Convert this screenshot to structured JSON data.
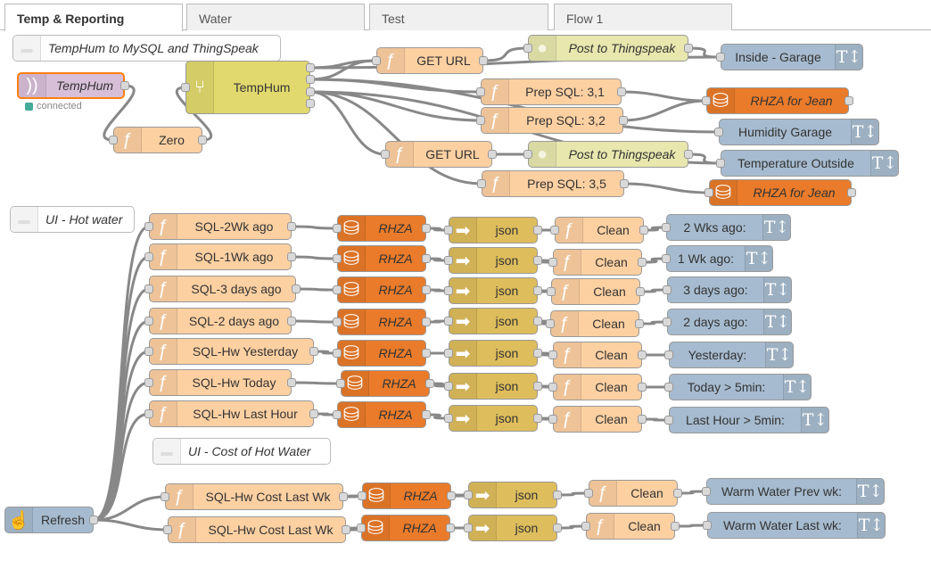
{
  "tabs": [
    {
      "label": "Temp & Reporting",
      "active": true
    },
    {
      "label": "Water"
    },
    {
      "label": "Test"
    },
    {
      "label": "Flow 1"
    }
  ],
  "colors": {
    "function": "#fdd0a2",
    "mysql": "#e97b2a",
    "json": "#debd5c",
    "ui": "#a6bbcf",
    "http": "#e7e7ae",
    "switch": "#e2d96e",
    "mqtt": "#d8bfd8",
    "inject": "#a6bbcf",
    "comment": "#ffffff",
    "wire": "#888888",
    "selected": "#ff7f0e"
  },
  "icons": {
    "function": "function-icon",
    "mysql": "database-icon",
    "json": "json-arrow-icon",
    "ui": "text-icon",
    "http": "globe-icon",
    "switch": "switch-icon",
    "mqtt": "mqtt-icon",
    "inject": "hand-pointer-icon",
    "comment": "comment-icon"
  },
  "nodes": [
    {
      "id": "c1",
      "type": "comment",
      "label": "TempHum to MySQL and ThingSpeak"
    },
    {
      "id": "mq",
      "type": "mqtt",
      "label": "TempHum",
      "italic": true,
      "selected": true,
      "status": "connected"
    },
    {
      "id": "zero",
      "type": "function",
      "label": "Zero"
    },
    {
      "id": "sw",
      "type": "switch",
      "label": "TempHum"
    },
    {
      "id": "get1",
      "type": "function",
      "label": "GET URL"
    },
    {
      "id": "post1",
      "type": "http",
      "label": "Post to Thingspeak",
      "italic": true
    },
    {
      "id": "ig",
      "type": "ui",
      "label": "Inside - Garage"
    },
    {
      "id": "ps31",
      "type": "function",
      "label": "Prep SQL: 3,1"
    },
    {
      "id": "rh1",
      "type": "mysql",
      "label": "RHZA for Jean",
      "italic": true
    },
    {
      "id": "ps32",
      "type": "function",
      "label": "Prep SQL: 3,2"
    },
    {
      "id": "hg",
      "type": "ui",
      "label": "Humidity Garage"
    },
    {
      "id": "get2",
      "type": "function",
      "label": "GET URL"
    },
    {
      "id": "post2",
      "type": "http",
      "label": "Post to Thingspeak",
      "italic": true
    },
    {
      "id": "to",
      "type": "ui",
      "label": "Temperature Outside"
    },
    {
      "id": "ps35",
      "type": "function",
      "label": "Prep SQL: 3,5"
    },
    {
      "id": "rh2",
      "type": "mysql",
      "label": "RHZA for Jean",
      "italic": true
    },
    {
      "id": "c2",
      "type": "comment",
      "label": "UI - Hot water"
    },
    {
      "id": "f1",
      "type": "function",
      "label": "SQL-2Wk ago"
    },
    {
      "id": "d1",
      "type": "mysql",
      "label": "RHZA",
      "italic": true
    },
    {
      "id": "j1",
      "type": "json",
      "label": "json"
    },
    {
      "id": "k1",
      "type": "function",
      "label": "Clean"
    },
    {
      "id": "u1",
      "type": "ui",
      "label": "2 Wks ago:"
    },
    {
      "id": "f2",
      "type": "function",
      "label": "SQL-1Wk ago"
    },
    {
      "id": "d2",
      "type": "mysql",
      "label": "RHZA",
      "italic": true
    },
    {
      "id": "j2",
      "type": "json",
      "label": "json"
    },
    {
      "id": "k2",
      "type": "function",
      "label": "Clean"
    },
    {
      "id": "u2",
      "type": "ui",
      "label": "1 Wk ago:"
    },
    {
      "id": "f3",
      "type": "function",
      "label": "SQL-3 days ago"
    },
    {
      "id": "d3",
      "type": "mysql",
      "label": "RHZA",
      "italic": true
    },
    {
      "id": "j3",
      "type": "json",
      "label": "json"
    },
    {
      "id": "k3",
      "type": "function",
      "label": "Clean"
    },
    {
      "id": "u3",
      "type": "ui",
      "label": "3 days ago:"
    },
    {
      "id": "f4",
      "type": "function",
      "label": "SQL-2 days ago"
    },
    {
      "id": "d4",
      "type": "mysql",
      "label": "RHZA",
      "italic": true
    },
    {
      "id": "j4",
      "type": "json",
      "label": "json"
    },
    {
      "id": "k4",
      "type": "function",
      "label": "Clean"
    },
    {
      "id": "u4",
      "type": "ui",
      "label": "2 days ago:"
    },
    {
      "id": "f5",
      "type": "function",
      "label": "SQL-Hw Yesterday"
    },
    {
      "id": "d5",
      "type": "mysql",
      "label": "RHZA",
      "italic": true
    },
    {
      "id": "j5",
      "type": "json",
      "label": "json"
    },
    {
      "id": "k5",
      "type": "function",
      "label": "Clean"
    },
    {
      "id": "u5",
      "type": "ui",
      "label": "Yesterday:"
    },
    {
      "id": "f6",
      "type": "function",
      "label": "SQL-Hw Today"
    },
    {
      "id": "d6",
      "type": "mysql",
      "label": "RHZA",
      "italic": true
    },
    {
      "id": "j6",
      "type": "json",
      "label": "json"
    },
    {
      "id": "k6",
      "type": "function",
      "label": "Clean"
    },
    {
      "id": "u6",
      "type": "ui",
      "label": "Today > 5min:"
    },
    {
      "id": "f7",
      "type": "function",
      "label": "SQL-Hw Last Hour"
    },
    {
      "id": "d7",
      "type": "mysql",
      "label": "RHZA",
      "italic": true
    },
    {
      "id": "j7",
      "type": "json",
      "label": "json"
    },
    {
      "id": "k7",
      "type": "function",
      "label": "Clean"
    },
    {
      "id": "u7",
      "type": "ui",
      "label": "Last Hour > 5min:"
    },
    {
      "id": "c3",
      "type": "comment",
      "label": "UI - Cost of Hot Water"
    },
    {
      "id": "ref",
      "type": "inject",
      "label": "Refresh"
    },
    {
      "id": "f8",
      "type": "function",
      "label": "SQL-Hw Cost Last Wk"
    },
    {
      "id": "d8",
      "type": "mysql",
      "label": "RHZA",
      "italic": true
    },
    {
      "id": "j8",
      "type": "json",
      "label": "json"
    },
    {
      "id": "k8",
      "type": "function",
      "label": "Clean"
    },
    {
      "id": "u8",
      "type": "ui",
      "label": "Warm Water Prev wk:"
    },
    {
      "id": "f9",
      "type": "function",
      "label": "SQL-Hw Cost Last Wk"
    },
    {
      "id": "d9",
      "type": "mysql",
      "label": "RHZA",
      "italic": true
    },
    {
      "id": "j9",
      "type": "json",
      "label": "json"
    },
    {
      "id": "k9",
      "type": "function",
      "label": "Clean"
    },
    {
      "id": "u9",
      "type": "ui",
      "label": "Warm Water Last wk:"
    }
  ],
  "wires": [
    [
      "mq",
      0,
      "zero"
    ],
    [
      "zero",
      0,
      "sw"
    ],
    [
      "sw",
      0,
      "get1"
    ],
    [
      "sw",
      0,
      "ig"
    ],
    [
      "sw",
      1,
      "get1"
    ],
    [
      "sw",
      1,
      "ps31"
    ],
    [
      "sw",
      1,
      "hg"
    ],
    [
      "sw",
      2,
      "ps32"
    ],
    [
      "sw",
      2,
      "get2"
    ],
    [
      "sw",
      2,
      "ps35"
    ],
    [
      "sw",
      2,
      "to"
    ],
    [
      "get1",
      0,
      "post1"
    ],
    [
      "ps31",
      0,
      "rh1"
    ],
    [
      "ps32",
      0,
      "rh1"
    ],
    [
      "get2",
      0,
      "post2"
    ],
    [
      "ps35",
      0,
      "rh2"
    ],
    [
      "post1",
      0,
      "ig"
    ],
    [
      "post2",
      0,
      "to"
    ],
    [
      "f1",
      0,
      "d1"
    ],
    [
      "d1",
      0,
      "j1"
    ],
    [
      "j1",
      0,
      "k1"
    ],
    [
      "k1",
      0,
      "u1"
    ],
    [
      "f2",
      0,
      "d2"
    ],
    [
      "d2",
      0,
      "j2"
    ],
    [
      "j2",
      0,
      "k2"
    ],
    [
      "k2",
      0,
      "u2"
    ],
    [
      "f3",
      0,
      "d3"
    ],
    [
      "d3",
      0,
      "j3"
    ],
    [
      "j3",
      0,
      "k3"
    ],
    [
      "k3",
      0,
      "u3"
    ],
    [
      "f4",
      0,
      "d4"
    ],
    [
      "d4",
      0,
      "j4"
    ],
    [
      "j4",
      0,
      "k4"
    ],
    [
      "k4",
      0,
      "u4"
    ],
    [
      "f5",
      0,
      "d5"
    ],
    [
      "d5",
      0,
      "j5"
    ],
    [
      "j5",
      0,
      "k5"
    ],
    [
      "k5",
      0,
      "u5"
    ],
    [
      "f6",
      0,
      "d6"
    ],
    [
      "d6",
      0,
      "j6"
    ],
    [
      "j6",
      0,
      "k6"
    ],
    [
      "k6",
      0,
      "u6"
    ],
    [
      "f7",
      0,
      "d7"
    ],
    [
      "d7",
      0,
      "j7"
    ],
    [
      "j7",
      0,
      "k7"
    ],
    [
      "k7",
      0,
      "u7"
    ],
    [
      "f8",
      0,
      "d8"
    ],
    [
      "d8",
      0,
      "j8"
    ],
    [
      "j8",
      0,
      "k8"
    ],
    [
      "k8",
      0,
      "u8"
    ],
    [
      "f9",
      0,
      "d9"
    ],
    [
      "d9",
      0,
      "j9"
    ],
    [
      "j9",
      0,
      "k9"
    ],
    [
      "k9",
      0,
      "u9"
    ],
    [
      "ref",
      0,
      "f1"
    ],
    [
      "ref",
      0,
      "f2"
    ],
    [
      "ref",
      0,
      "f3"
    ],
    [
      "ref",
      0,
      "f4"
    ],
    [
      "ref",
      0,
      "f5"
    ],
    [
      "ref",
      0,
      "f6"
    ],
    [
      "ref",
      0,
      "f7"
    ],
    [
      "ref",
      0,
      "f8"
    ],
    [
      "ref",
      0,
      "f9"
    ]
  ]
}
